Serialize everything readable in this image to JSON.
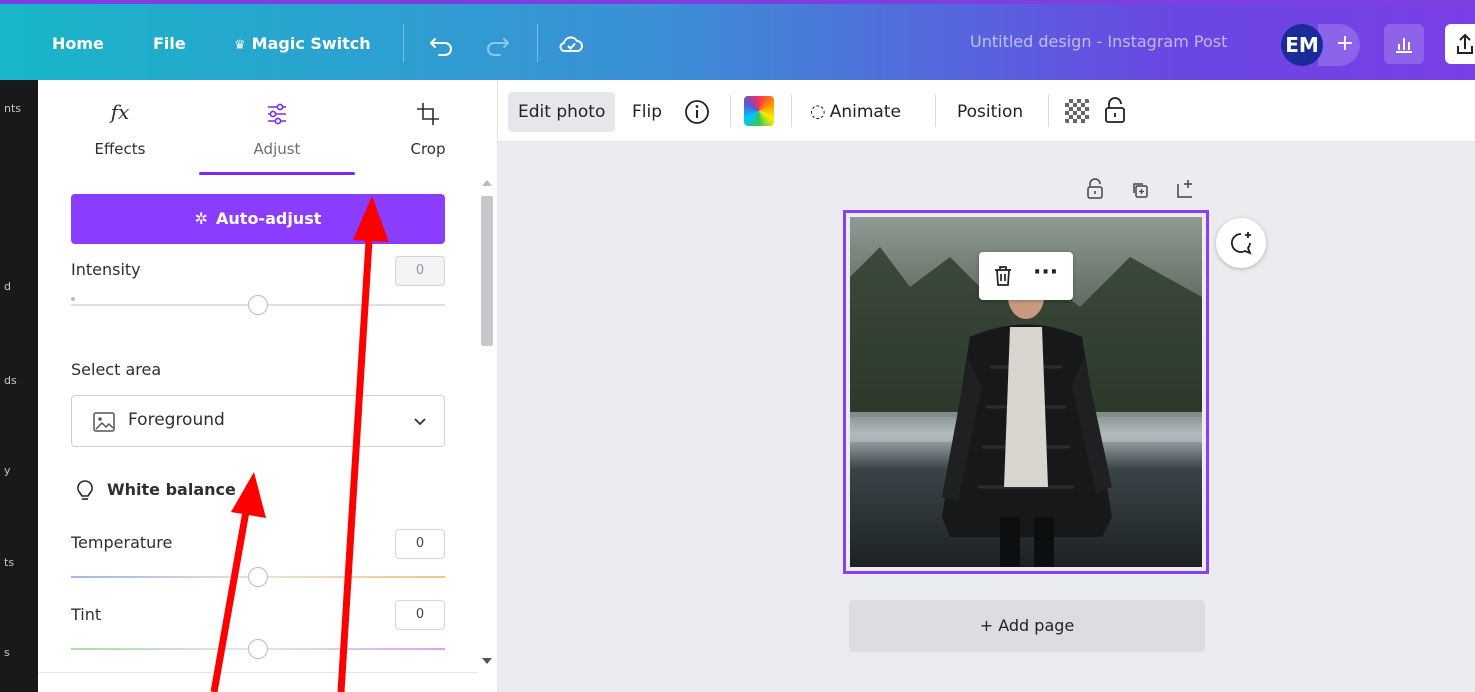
{
  "topbar": {
    "home": "Home",
    "file": "File",
    "magic_switch": "Magic Switch",
    "design_title": "Untitled design - Instagram Post",
    "avatar_initials": "EM",
    "add_label": "+"
  },
  "rail": {
    "labels": [
      "nts",
      "d",
      "ds",
      "y",
      "ts",
      "s"
    ]
  },
  "panel": {
    "tabs": [
      {
        "label": "Effects",
        "icon": "fx-icon"
      },
      {
        "label": "Adjust",
        "icon": "sliders-icon"
      },
      {
        "label": "Crop",
        "icon": "crop-icon"
      }
    ],
    "active_tab": "Adjust",
    "auto_adjust": "Auto-adjust",
    "intensity_label": "Intensity",
    "intensity_value": "0",
    "select_area_label": "Select area",
    "select_area_value": "Foreground",
    "white_balance_label": "White balance",
    "temperature_label": "Temperature",
    "temperature_value": "0",
    "tint_label": "Tint",
    "tint_value": "0"
  },
  "context_bar": {
    "edit_photo": "Edit photo",
    "flip": "Flip",
    "animate": "Animate",
    "position": "Position"
  },
  "canvas": {
    "add_page": "+ Add page"
  },
  "colors": {
    "accent": "#8b3dff",
    "annotation_arrow": "#ff0000"
  }
}
